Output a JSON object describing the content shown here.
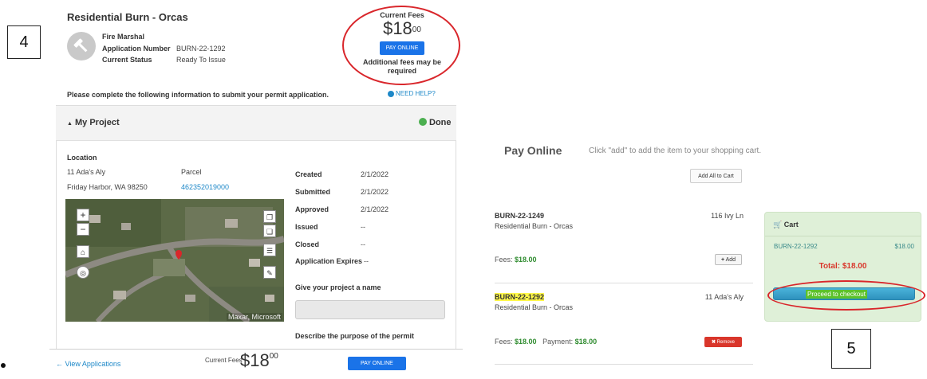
{
  "annotations": {
    "step_left": "4",
    "step_right": "5"
  },
  "permit": {
    "title": "Residential Burn - Orcas",
    "department": "Fire Marshal",
    "app_number_label": "Application Number",
    "app_number": "BURN-22-1292",
    "status_label": "Current Status",
    "status": "Ready To Issue",
    "fees_label": "Current Fees",
    "fees_main": "$18",
    "fees_cents": "00",
    "pay_label": "PAY ONLINE",
    "additional_note": "Additional fees may be required",
    "instructions": "Please complete the following information to submit your permit application.",
    "help": "NEED HELP?"
  },
  "project": {
    "title": "My Project",
    "done": "Done",
    "location_label": "Location",
    "address1": "11 Ada's Aly",
    "address2": "Friday Harbor, WA 98250",
    "parcel_label": "Parcel",
    "parcel": "462352019000",
    "dates": [
      {
        "label": "Created",
        "value": "2/1/2022"
      },
      {
        "label": "Submitted",
        "value": "2/1/2022"
      },
      {
        "label": "Approved",
        "value": "2/1/2022"
      },
      {
        "label": "Issued",
        "value": "--"
      },
      {
        "label": "Closed",
        "value": "--"
      },
      {
        "label": "Application Expires",
        "value": "--"
      }
    ],
    "name_label": "Give your project a name",
    "purpose_label": "Describe the purpose of the permit",
    "map_attribution": "Maxar, Microsoft",
    "map_zoom_in": "+",
    "map_zoom_out": "−"
  },
  "footer": {
    "view_apps": "← View Applications",
    "fees_label": "Current Fees",
    "fees_main": "$18",
    "fees_cents": "00",
    "pay_label": "PAY ONLINE"
  },
  "pay_online": {
    "title": "Pay Online",
    "subtitle": "Click \"add\" to add the item to your shopping cart.",
    "add_all": "Add All to Cart",
    "items": [
      {
        "id": "BURN-22-1249",
        "desc": "Residential Burn - Orcas",
        "addr": "116 Ivy Ln",
        "fees_label": "Fees:",
        "fees": "$18.00",
        "action": "Add"
      },
      {
        "id": "BURN-22-1292",
        "desc": "Residential Burn - Orcas",
        "addr": "11 Ada's Aly",
        "fees_label": "Fees:",
        "fees": "$18.00",
        "payment_label": "Payment:",
        "payment": "$18.00",
        "action": "Remove"
      }
    ]
  },
  "cart": {
    "title": "Cart",
    "item": "BURN-22-1292",
    "price": "$18.00",
    "total": "Total: $18.00",
    "checkout": "Proceed to checkout"
  },
  "colors": {
    "highlight_oval": "#d9262b",
    "primary_button": "#1a73e8",
    "cart_bg": "#dff0d8",
    "total_red": "#d9362b",
    "fee_green": "#2e8b2e"
  }
}
